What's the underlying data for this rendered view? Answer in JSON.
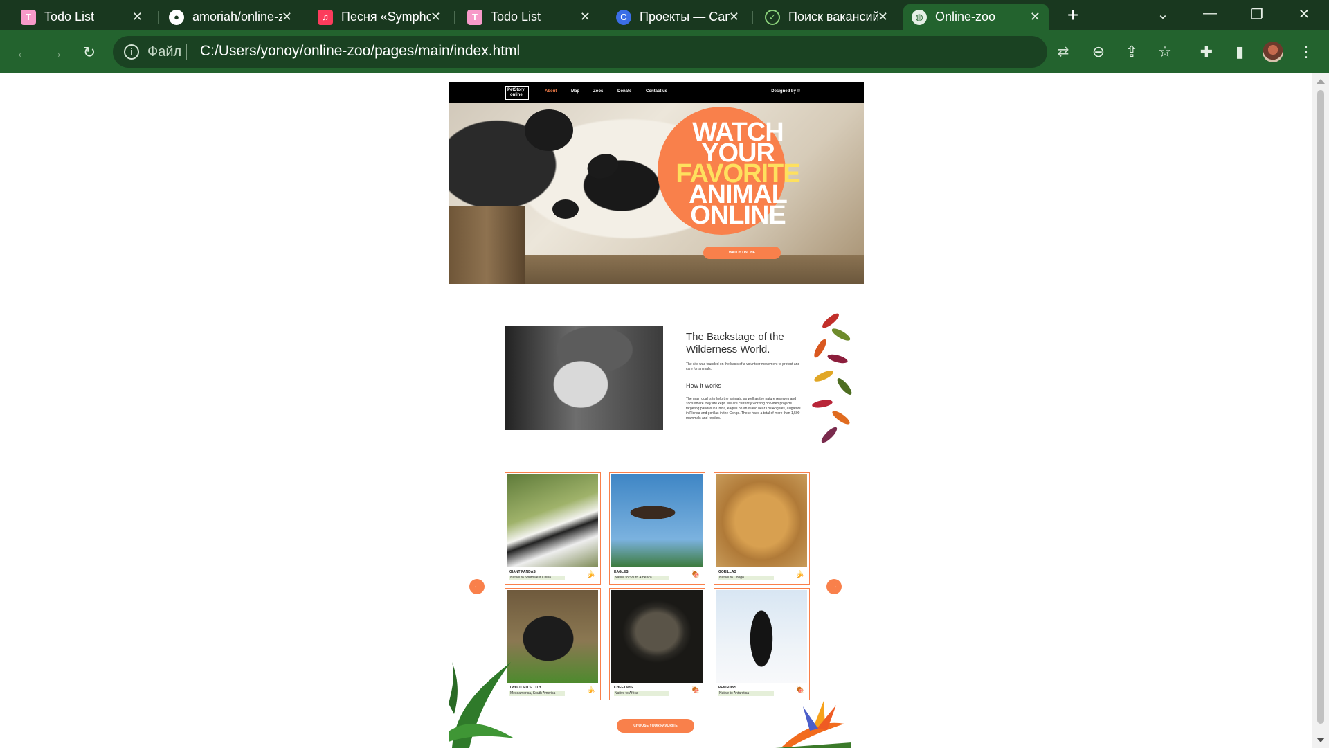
{
  "browser": {
    "tabs": [
      {
        "title": "Todo List",
        "icon": "todo-favicon-icon",
        "active": false
      },
      {
        "title": "amoriah/online-zoo",
        "icon": "github-icon",
        "active": false
      },
      {
        "title": "Песня «Symphony»",
        "icon": "music-icon",
        "active": false
      },
      {
        "title": "Todo List",
        "icon": "todo-favicon-icon",
        "active": false
      },
      {
        "title": "Проекты — Canva",
        "icon": "canva-icon",
        "active": false
      },
      {
        "title": "Поиск вакансий",
        "icon": "job-search-icon",
        "active": false
      },
      {
        "title": "Online-zoo",
        "icon": "globe-icon",
        "active": true
      }
    ],
    "address": {
      "scheme_label": "Файл",
      "url": "C:/Users/yonoy/online-zoo/pages/main/index.html"
    },
    "colors": {
      "frame": "#19381f",
      "toolbar": "#23632e"
    }
  },
  "site": {
    "logo": {
      "line1": "PetStory",
      "line2": "online"
    },
    "nav": [
      {
        "label": "About",
        "active": true
      },
      {
        "label": "Map",
        "active": false
      },
      {
        "label": "Zoos",
        "active": false
      },
      {
        "label": "Donate",
        "active": false
      },
      {
        "label": "Contact us",
        "active": false
      }
    ],
    "designed_by": "Designed by ©",
    "hero": {
      "line1": "WATCH",
      "line2": "YOUR",
      "line3": "FAVORITE",
      "line4": "ANIMAL",
      "line5": "ONLINE",
      "button": "WATCH ONLINE"
    },
    "about": {
      "title": "The Backstage of the Wilderness World.",
      "intro": "The site was founded on the basis of a volunteer movement to protect and care for animals.",
      "subtitle": "How it works",
      "body": "The main goal is to help the animals, as well as the nature reserves and zoos where they are kept. We are currently working on video projects targeting pandas in China, eagles on an island near Los Angeles, alligators in Florida and gorillas in the Congo. These have a total of more than 1,500 mammals and reptiles."
    },
    "pets": [
      {
        "name": "GIANT PANDAS",
        "native": "Native to Southwest China",
        "food": "banana-icon"
      },
      {
        "name": "EAGLES",
        "native": "Native to South America",
        "food": "meat-icon"
      },
      {
        "name": "GORILLAS",
        "native": "Native to Congo",
        "food": "banana-icon"
      },
      {
        "name": "TWO-TOED SLOTH",
        "native": "Mesoamerica, South America",
        "food": "banana-icon"
      },
      {
        "name": "CHEETAHS",
        "native": "Native to Africa",
        "food": "meat-icon"
      },
      {
        "name": "PENGUINS",
        "native": "Native to Antarctica",
        "food": "meat-icon"
      }
    ],
    "choose_button": "CHOOSE YOUR FAVORITE",
    "accent": "#f9804b",
    "highlight": "#fee05e"
  }
}
